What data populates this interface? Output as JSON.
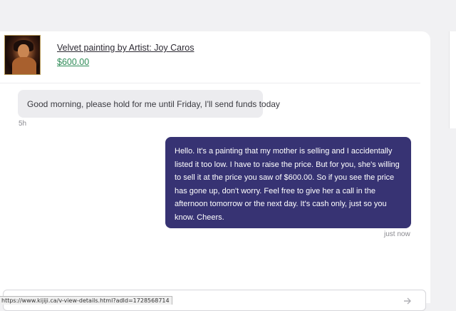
{
  "listing": {
    "title": "Velvet painting by Artist: Joy Caros",
    "price": "$600.00",
    "thumbnail_icon": "velvet-painting-thumbnail"
  },
  "messages": [
    {
      "direction": "incoming",
      "text": "Good morning, please hold for me until Friday, I'll send funds today",
      "time": "5h"
    },
    {
      "direction": "outgoing",
      "text": "Hello. It's a painting that my mother is selling and I accidentally listed it too low. I have to raise the price. But for you, she's willing to sell it at the price you saw of $600.00. So if you see the price has gone up, don't worry.  Feel free to give her a call in the afternoon tomorrow or the next day. It's cash only, just so you know. Cheers.",
      "time": "just now"
    }
  ],
  "compose": {
    "send_icon": "send-arrow-icon"
  },
  "status_bar": {
    "url": "https://www.kijiji.ca/v-view-details.html?adId=1728568714"
  },
  "colors": {
    "outgoing_bubble": "#373373",
    "incoming_bubble": "#ececef",
    "price_link": "#2e8b57"
  }
}
